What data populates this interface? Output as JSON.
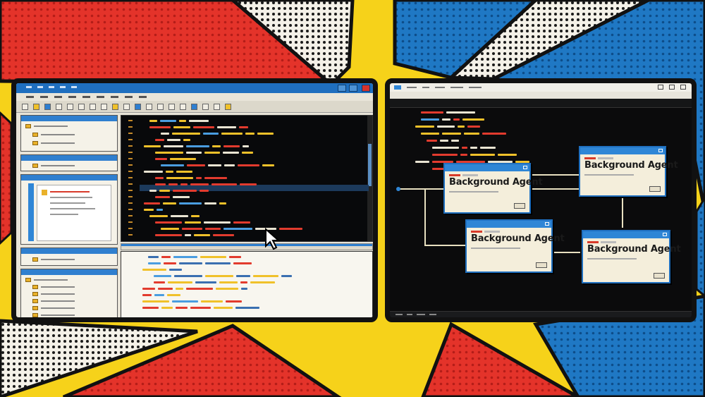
{
  "colors": {
    "comic_red": "#e4332a",
    "comic_yellow": "#f6d21a",
    "comic_blue": "#1f78c4",
    "titlebar_blue": "#1f6fbf",
    "editor_bg": "#08090b",
    "agent_card_bg": "#f4eedb"
  },
  "left_window": {
    "icons": [
      "folder-icon",
      "save-icon",
      "settings-icon",
      "close-icon"
    ]
  },
  "right_window": {
    "agents": [
      {
        "title": "Background Agent"
      },
      {
        "title": "Background Agent"
      },
      {
        "title": "Background Agent"
      },
      {
        "title": "Background Agent"
      }
    ]
  }
}
